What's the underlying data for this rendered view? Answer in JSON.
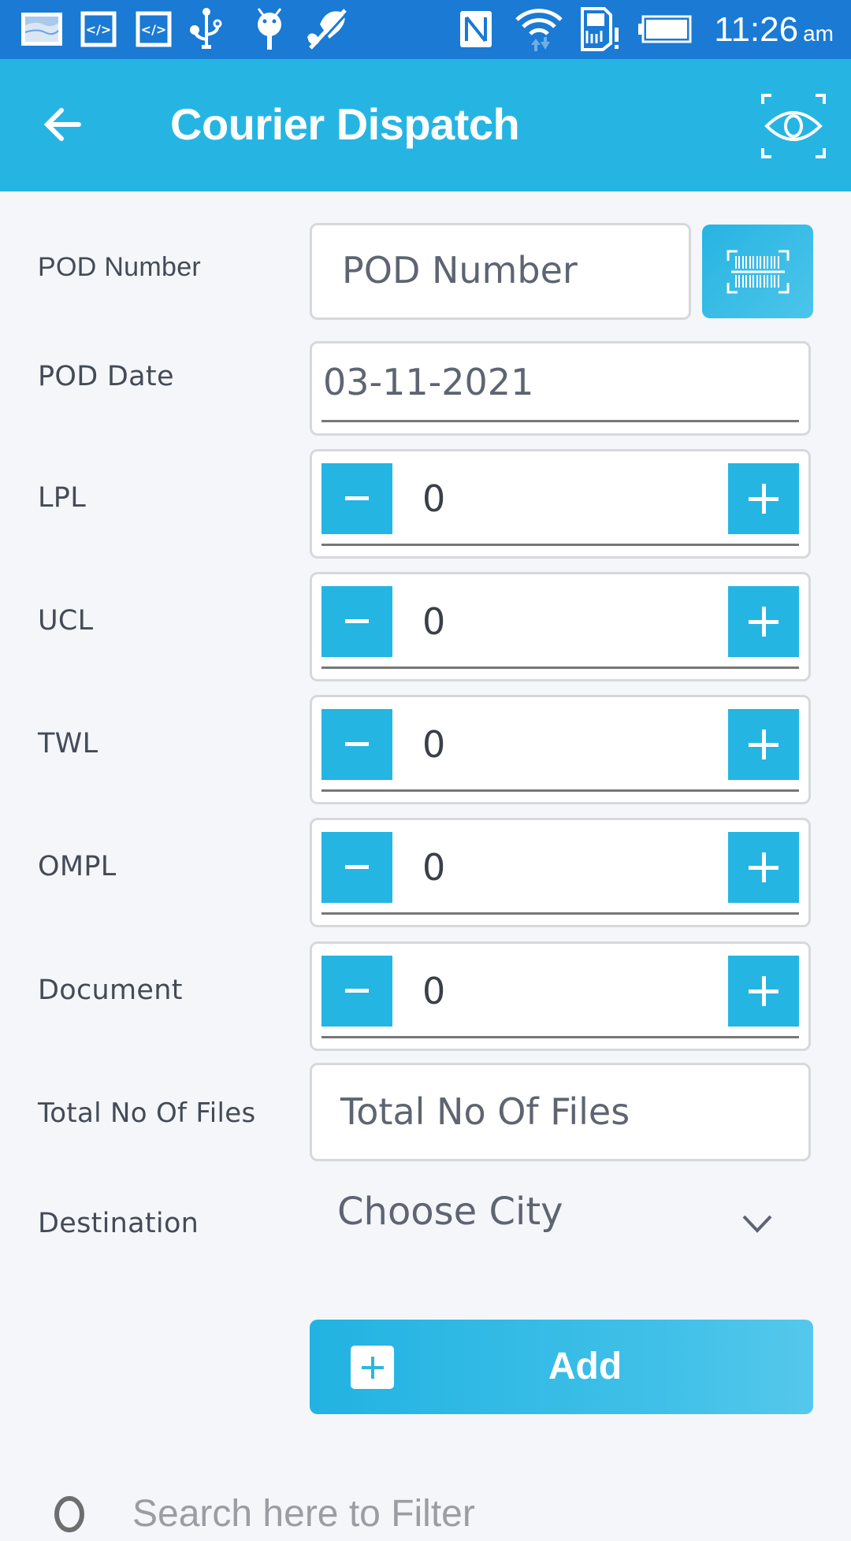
{
  "status_bar": {
    "time": "11:26",
    "ampm": "am",
    "left_icons": [
      "gallery-notification-icon",
      "code-notification-icon",
      "code-notification-icon",
      "usb-icon",
      "android-debug-icon",
      "no-location-icon"
    ],
    "right_icons": [
      "nfc-icon",
      "wifi-icon",
      "sim-alert-icon",
      "battery-icon"
    ]
  },
  "app_bar": {
    "title": "Courier Dispatch",
    "back_icon": "arrow-left-icon",
    "action_icon": "eye-scan-icon"
  },
  "form": {
    "pod_number": {
      "label": "POD Number",
      "placeholder": "POD Number",
      "value": "",
      "scan_icon": "barcode-scan-icon"
    },
    "pod_date": {
      "label": "POD Date",
      "value": "03-11-2021"
    },
    "steppers": [
      {
        "label": "LPL",
        "value": "0",
        "minus": "−",
        "plus": "+"
      },
      {
        "label": "UCL",
        "value": "0",
        "minus": "−",
        "plus": "+"
      },
      {
        "label": "TWL",
        "value": "0",
        "minus": "−",
        "plus": "+"
      },
      {
        "label": "OMPL",
        "value": "0",
        "minus": "−",
        "plus": "+"
      },
      {
        "label": "Document",
        "value": "0",
        "minus": "−",
        "plus": "+"
      }
    ],
    "total_files": {
      "label": "Total No Of Files",
      "placeholder": "Total No Of Files",
      "value": ""
    },
    "destination": {
      "label": "Destination",
      "selected": "Choose City"
    },
    "add_button": {
      "label": "Add",
      "icon": "plus-square-icon"
    }
  },
  "search": {
    "placeholder": "Search here to Filter"
  },
  "colors": {
    "status_bar": "#1a7ad4",
    "app_bar": "#26b5e3",
    "accent": "#25b5e3",
    "background": "#f4f6f9"
  }
}
